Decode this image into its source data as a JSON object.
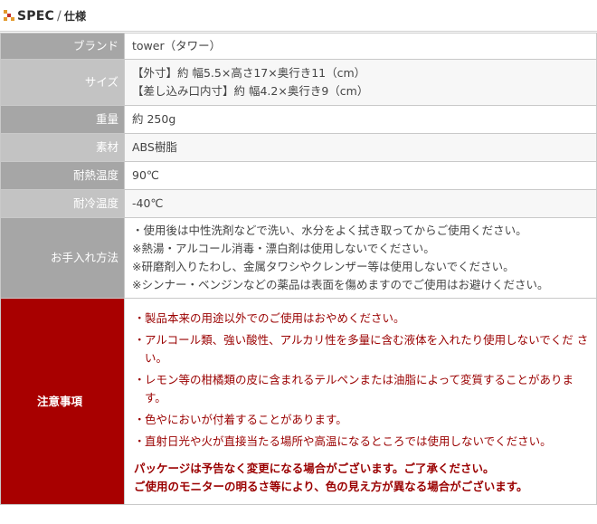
{
  "header": {
    "title": "SPEC",
    "separator": "/",
    "subtitle": "仕様",
    "icon_colors": [
      "#e39a2c",
      "#c4302b"
    ]
  },
  "rows": [
    {
      "label": "ブランド",
      "lines": [
        "tower（タワー）"
      ]
    },
    {
      "label": "サイズ",
      "lines": [
        "【外寸】約 幅5.5×高さ17×奥行き11（cm）",
        "【差し込み口内寸】約 幅4.2×奥行き9（cm）"
      ]
    },
    {
      "label": "重量",
      "lines": [
        "約 250g"
      ]
    },
    {
      "label": "素材",
      "lines": [
        "ABS樹脂"
      ]
    },
    {
      "label": "耐熱温度",
      "lines": [
        "90℃"
      ]
    },
    {
      "label": "耐冷温度",
      "lines": [
        "-40℃"
      ]
    },
    {
      "label": "お手入れ方法",
      "lines": [
        "・使用後は中性洗剤などで洗い、水分をよく拭き取ってからご使用ください。",
        "※熱湯・アルコール消毒・漂白剤は使用しないでください。",
        "※研磨剤入りたわし、金属タワシやクレンザー等は使用しないでください。",
        "※シンナー・ベンジンなどの薬品は表面を傷めますのでご使用はお避けください。"
      ]
    }
  ],
  "caution": {
    "label": "注意事項",
    "bullet": "・",
    "items": [
      "製品本来の用途以外でのご使用はおやめください。",
      "アルコール類、強い酸性、アルカリ性を多量に含む液体を入れたり使用しないでくだ さい。",
      "レモン等の柑橘類の皮に含まれるテルペンまたは油脂によって変質することがありま す。",
      "色やにおいが付着することがあります。",
      "直射日光や火が直接当たる場所や高温になるところでは使用しないでください。"
    ],
    "notes": [
      "パッケージは予告なく変更になる場合がございます。ご了承ください。",
      "ご使用のモニターの明るさ等により、色の見え方が異なる場合がございます。"
    ]
  }
}
